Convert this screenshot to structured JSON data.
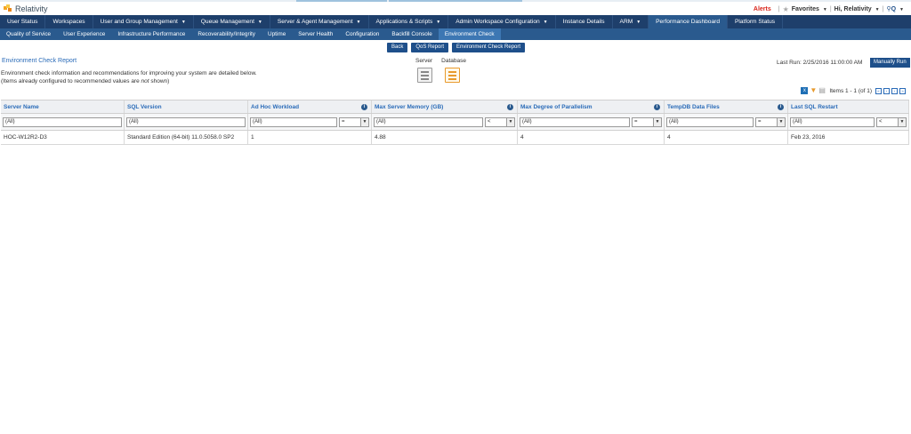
{
  "app": {
    "name": "Relativity"
  },
  "userbar": {
    "alerts": "Alerts",
    "favorites": "Favorites",
    "greeting": "Hi, Relativity",
    "search_label": "Q"
  },
  "main_nav": [
    {
      "label": "User Status",
      "dropdown": false
    },
    {
      "label": "Workspaces",
      "dropdown": false
    },
    {
      "label": "User and Group Management",
      "dropdown": true
    },
    {
      "label": "Queue Management",
      "dropdown": true
    },
    {
      "label": "Server & Agent Management",
      "dropdown": true
    },
    {
      "label": "Applications & Scripts",
      "dropdown": true
    },
    {
      "label": "Admin Workspace Configuration",
      "dropdown": true
    },
    {
      "label": "Instance Details",
      "dropdown": false
    },
    {
      "label": "ARM",
      "dropdown": true
    },
    {
      "label": "Performance Dashboard",
      "dropdown": false,
      "active": true
    },
    {
      "label": "Platform Status",
      "dropdown": false
    }
  ],
  "sub_nav": [
    {
      "label": "Quality of Service"
    },
    {
      "label": "User Experience"
    },
    {
      "label": "Infrastructure Performance"
    },
    {
      "label": "Recoverability/Integrity"
    },
    {
      "label": "Uptime"
    },
    {
      "label": "Server Health"
    },
    {
      "label": "Configuration"
    },
    {
      "label": "Backfill Console"
    },
    {
      "label": "Environment Check",
      "active": true
    }
  ],
  "actions": {
    "back": "Back",
    "qos_report": "QoS Report",
    "env_report": "Environment Check Report"
  },
  "report": {
    "title": "Environment Check Report",
    "desc_line1": "Environment check information and recommendations for improving your system are detailed below.",
    "desc_line2_pre": "(Items already configured to recommended values are ",
    "desc_line2_em": "not",
    "desc_line2_post": " shown)"
  },
  "view_toggle": {
    "server": "Server",
    "database": "Database",
    "selected": "database"
  },
  "last_run": {
    "label": "Last Run:",
    "value": "2/25/2016 11:00:00 AM"
  },
  "manual_run": "Manually Run",
  "pager": {
    "text": "Items 1 - 1 (of 1)",
    "first": "«",
    "prev": "‹",
    "next": "›",
    "last": "»"
  },
  "table": {
    "columns": [
      {
        "label": "Server Name",
        "info": false,
        "filter": "(All)",
        "op": null
      },
      {
        "label": "SQL Version",
        "info": false,
        "filter": "(All)",
        "op": null
      },
      {
        "label": "Ad Hoc Workload",
        "info": true,
        "filter": "(All)",
        "op": "="
      },
      {
        "label": "Max Server Memory (GB)",
        "info": true,
        "filter": "(All)",
        "op": "<"
      },
      {
        "label": "Max Degree of Parallelism",
        "info": true,
        "filter": "(All)",
        "op": "="
      },
      {
        "label": "TempDB Data Files",
        "info": true,
        "filter": "(All)",
        "op": "="
      },
      {
        "label": "Last SQL Restart",
        "info": false,
        "filter": "(All)",
        "op": "<"
      }
    ],
    "rows": [
      [
        "HOC-W12R2-D3",
        "Standard Edition (64-bit) 11.0.5058.0 SP2",
        "1",
        "4.88",
        "4",
        "4",
        "Feb 23, 2016"
      ]
    ]
  },
  "colors": {
    "nav_bg": "#1e3f6b",
    "subnav_bg": "#2a5a8e",
    "link": "#2a6bb8",
    "alert": "#d9261c",
    "selected_view": "#e89a2c"
  }
}
